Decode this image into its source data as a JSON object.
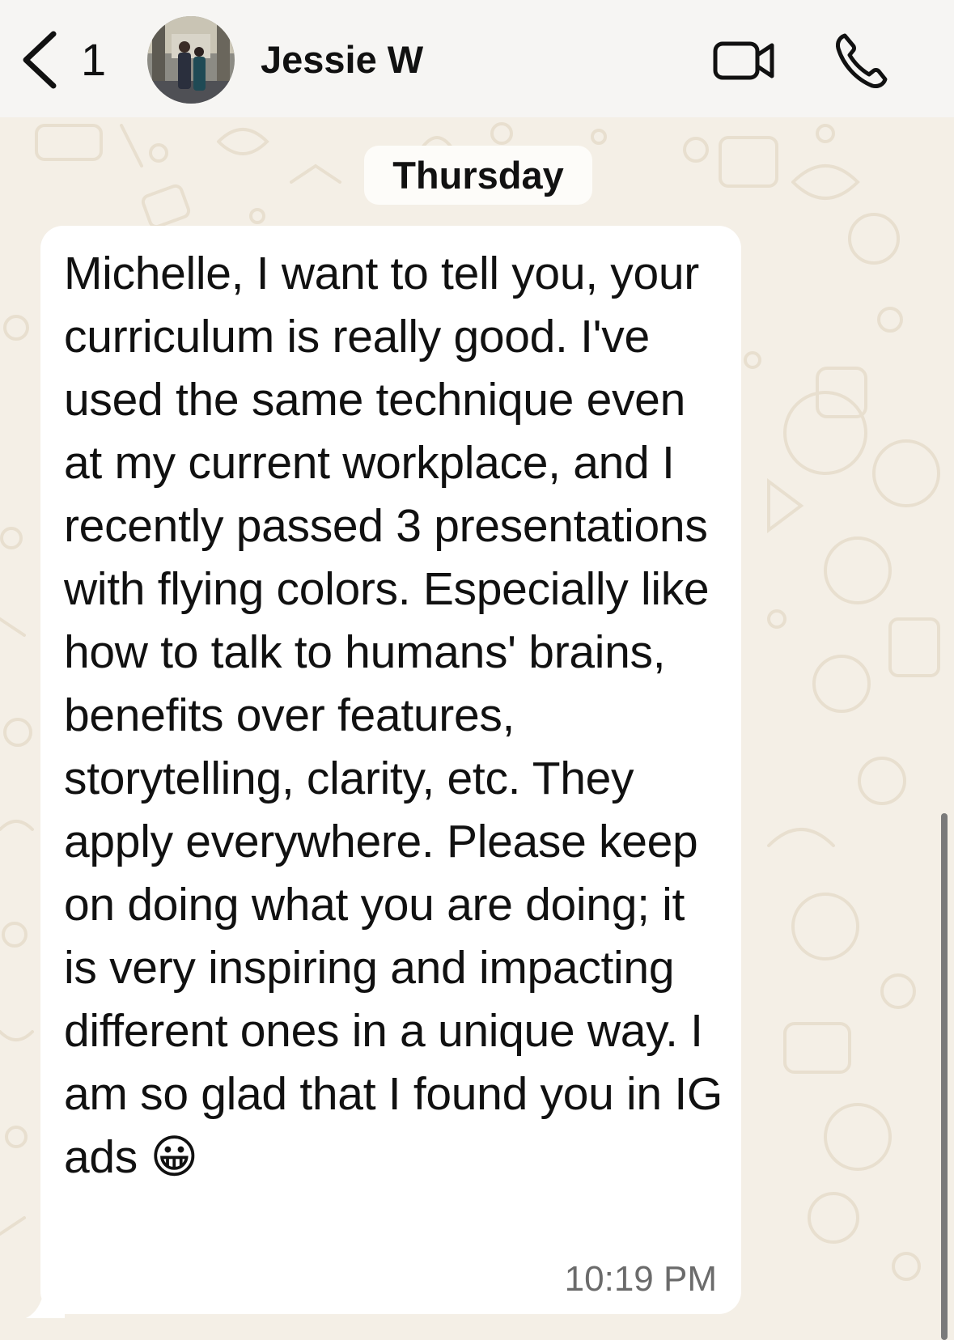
{
  "header": {
    "back_count": "1",
    "contact_name": "Jessie W",
    "icons": [
      "chevron-left-icon",
      "video-camera-icon",
      "phone-icon"
    ]
  },
  "chat": {
    "date_separator": "Thursday",
    "message": {
      "text": "Michelle, I want to tell you, your curriculum is really good. I've used the same technique even at my current workplace, and I recently passed 3 presentations with flying colors. Especially like how to talk to humans' brains, benefits over features, storytelling, clarity, etc. They apply everywhere. Please keep on doing what you are doing; it is very inspiring and impacting different ones in a unique way. I am so glad that I found you in IG ads",
      "emoji": "😀",
      "time": "10:19 PM"
    }
  },
  "colors": {
    "header_bg": "#f6f5f3",
    "wallpaper_bg": "#f4efe6",
    "bubble_bg": "#ffffff",
    "text": "#111111",
    "timestamp": "#6b6b6b"
  }
}
